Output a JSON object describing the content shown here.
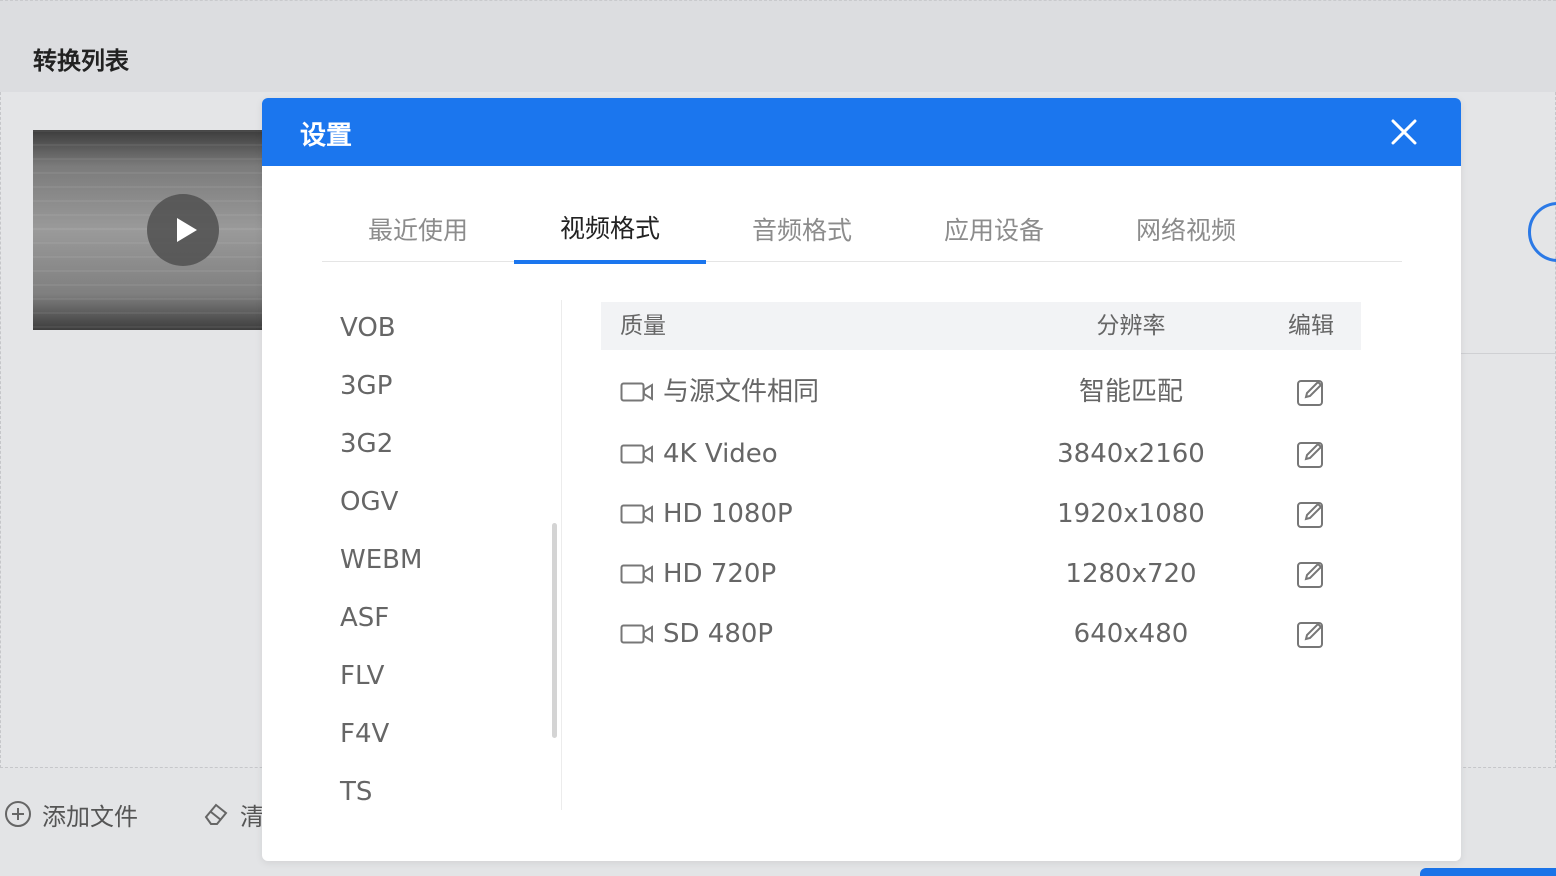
{
  "app": {
    "title": "转换列表",
    "add_file_label": "添加文件",
    "clear_label_partial": "清"
  },
  "dialog": {
    "title": "设置",
    "tabs": [
      {
        "label": "最近使用",
        "active": false
      },
      {
        "label": "视频格式",
        "active": true
      },
      {
        "label": "音频格式",
        "active": false
      },
      {
        "label": "应用设备",
        "active": false
      },
      {
        "label": "网络视频",
        "active": false
      }
    ],
    "formats": [
      "VOB",
      "3GP",
      "3G2",
      "OGV",
      "WEBM",
      "ASF",
      "FLV",
      "F4V",
      "TS"
    ],
    "table": {
      "headers": {
        "quality": "质量",
        "resolution": "分辨率",
        "edit": "编辑"
      },
      "rows": [
        {
          "name": "与源文件相同",
          "resolution": "智能匹配"
        },
        {
          "name": "4K Video",
          "resolution": "3840x2160"
        },
        {
          "name": "HD 1080P",
          "resolution": "1920x1080"
        },
        {
          "name": "HD 720P",
          "resolution": "1280x720"
        },
        {
          "name": "SD 480P",
          "resolution": "640x480"
        }
      ]
    }
  },
  "colors": {
    "accent": "#1b76ee",
    "header_bg": "#1b76ee",
    "muted_text": "#666666"
  },
  "icons": {
    "close": "close-icon",
    "play": "play-icon",
    "camera": "video-camera-icon",
    "edit": "edit-icon",
    "add": "plus-circle-icon",
    "clear": "eraser-icon"
  }
}
